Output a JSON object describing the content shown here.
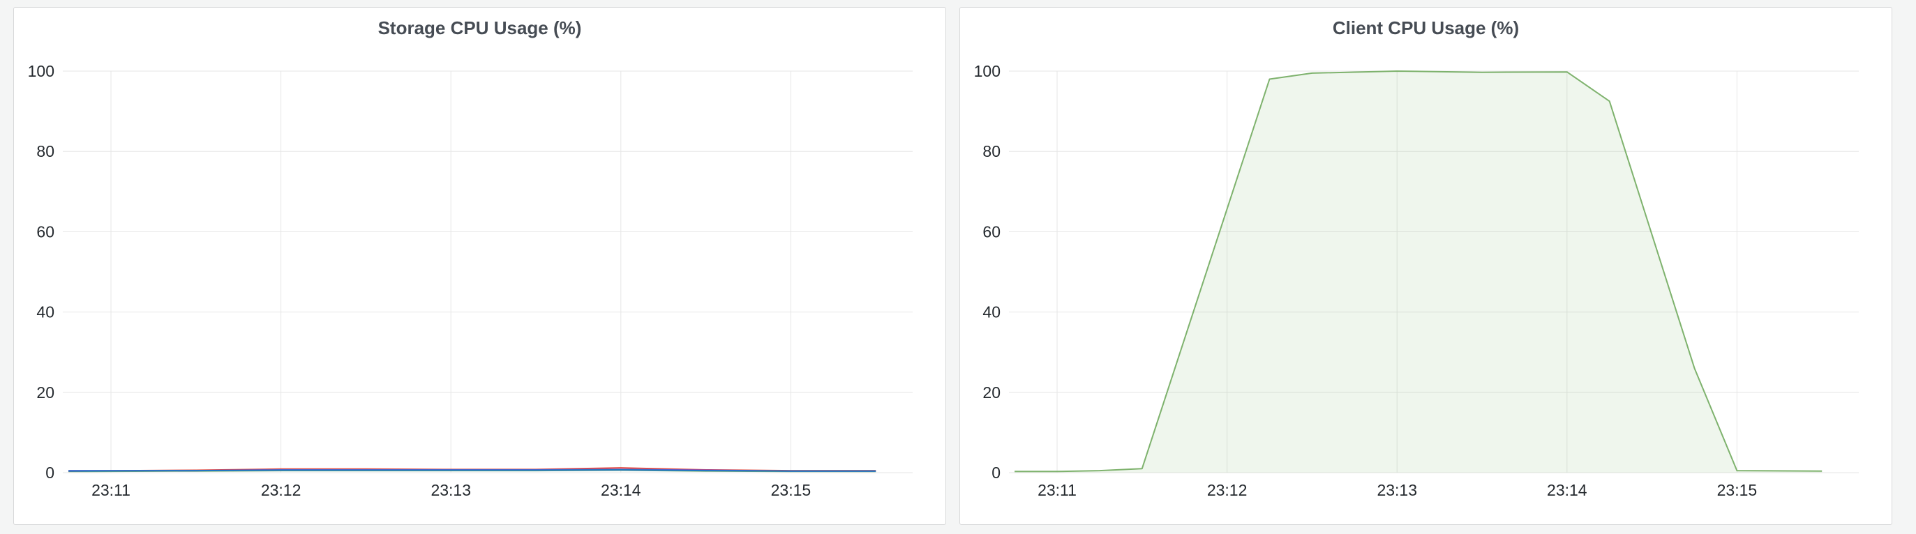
{
  "colors": {
    "grid": "#e6e6e6",
    "background": "#ffffff",
    "panel_bg": "#f4f5f5"
  },
  "chart_data": [
    {
      "type": "line",
      "title": "Storage CPU Usage (%)",
      "xlabel": "",
      "ylabel": "",
      "ylim": [
        0,
        100
      ],
      "yticks": [
        0,
        20,
        40,
        60,
        80,
        100
      ],
      "xlim": [
        "23:10:43",
        "23:15:43"
      ],
      "xticks": [
        "23:11",
        "23:12",
        "23:13",
        "23:14",
        "23:15"
      ],
      "grid": true,
      "fill": false,
      "series": [
        {
          "color": "#7eb26d",
          "x": [
            "23:10:45",
            "23:11:30",
            "23:12:00",
            "23:12:30",
            "23:13:00",
            "23:13:30",
            "23:14:00",
            "23:14:30",
            "23:15:00",
            "23:15:30"
          ],
          "values": [
            0.3,
            0.4,
            0.5,
            0.5,
            0.5,
            0.5,
            0.6,
            0.4,
            0.3,
            0.3
          ]
        },
        {
          "color": "#e24d42",
          "x": [
            "23:10:45",
            "23:11:30",
            "23:12:00",
            "23:12:30",
            "23:13:00",
            "23:13:30",
            "23:14:00",
            "23:14:30",
            "23:15:00",
            "23:15:30"
          ],
          "values": [
            0.4,
            0.6,
            0.9,
            0.9,
            0.8,
            0.8,
            1.2,
            0.7,
            0.5,
            0.5
          ]
        },
        {
          "color": "#6d4ed8",
          "x": [
            "23:10:45",
            "23:11:30",
            "23:12:00",
            "23:12:30",
            "23:13:00",
            "23:13:30",
            "23:14:00",
            "23:14:30",
            "23:15:00",
            "23:15:30"
          ],
          "values": [
            0.5,
            0.5,
            0.7,
            0.7,
            0.7,
            0.7,
            0.8,
            0.6,
            0.4,
            0.4
          ]
        },
        {
          "color": "#1f78c1",
          "x": [
            "23:10:45",
            "23:11:30",
            "23:12:00",
            "23:12:30",
            "23:13:00",
            "23:13:30",
            "23:14:00",
            "23:14:30",
            "23:15:00",
            "23:15:30"
          ],
          "values": [
            0.4,
            0.5,
            0.6,
            0.6,
            0.6,
            0.6,
            0.7,
            0.5,
            0.4,
            0.4
          ]
        }
      ]
    },
    {
      "type": "area",
      "title": "Client CPU Usage (%)",
      "xlabel": "",
      "ylabel": "",
      "ylim": [
        0,
        100
      ],
      "yticks": [
        0,
        20,
        40,
        60,
        80,
        100
      ],
      "xlim": [
        "23:10:43",
        "23:15:43"
      ],
      "xticks": [
        "23:11",
        "23:12",
        "23:13",
        "23:14",
        "23:15"
      ],
      "grid": true,
      "fill": true,
      "series": [
        {
          "color": "#7eb26d",
          "x": [
            "23:10:45",
            "23:11:00",
            "23:11:15",
            "23:11:30",
            "23:12:15",
            "23:12:30",
            "23:13:00",
            "23:13:30",
            "23:14:00",
            "23:14:15",
            "23:14:45",
            "23:15:00",
            "23:15:30"
          ],
          "values": [
            0.3,
            0.3,
            0.5,
            1,
            98,
            99.5,
            100,
            99.7,
            99.8,
            92.5,
            26,
            0.5,
            0.4
          ]
        }
      ]
    }
  ]
}
